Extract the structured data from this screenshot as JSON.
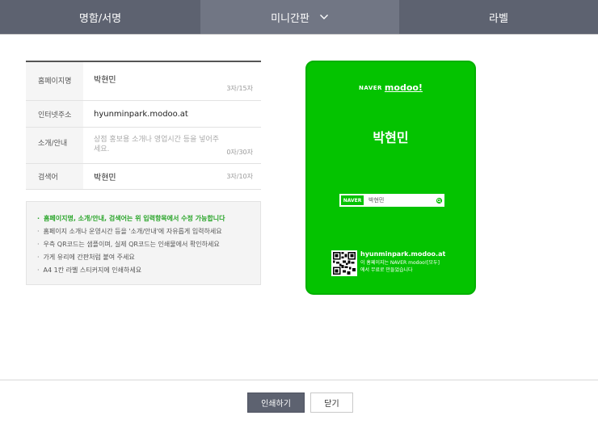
{
  "tabs": [
    {
      "label": "명함/서명"
    },
    {
      "label": "미니간판"
    },
    {
      "label": "라벨"
    }
  ],
  "form": {
    "rows": [
      {
        "label": "홈페이지명",
        "value": "박현민",
        "count": "3자/15자"
      },
      {
        "label": "인터넷주소",
        "value": "hyunminpark.modoo.at"
      },
      {
        "label": "소개/안내",
        "placeholder": "상점 홍보용 소개나 영업시간 등을 넣어주세요.",
        "count": "0자/30자"
      },
      {
        "label": "검색어",
        "value": "박현민",
        "count": "3자/10자"
      }
    ]
  },
  "notice": {
    "items": [
      "홈페이지명, 소개/안내, 검색어는 위 입력항목에서 수정 가능합니다",
      "홈페이지 소개나 운영시간 등을 '소개/안내'에 자유롭게 입력하세요",
      "우측 QR코드는 샘플이며, 실제 QR코드는 인쇄물에서 확인하세요",
      "가게 유리에 간판처럼 붙여 주세요",
      "A4 1칸 라벨 스티커지에 인쇄하세요"
    ]
  },
  "card": {
    "brand_naver": "NAVER",
    "brand_modoo": "modoo!",
    "title": "박현민",
    "search_brand": "NAVER",
    "search_text": "박현민",
    "url": "hyunminpark.modoo.at",
    "desc": "이 홈페이지는 NAVER modoo![모두]에서 무료로 만들었습니다",
    "bg_color": "#04c300"
  },
  "buttons": {
    "print": "인쇄하기",
    "close": "닫기"
  },
  "colors": {
    "tab_bg": "#5d6270",
    "tab_active_bg": "#717684",
    "notice_highlight": "#2aa52a"
  }
}
